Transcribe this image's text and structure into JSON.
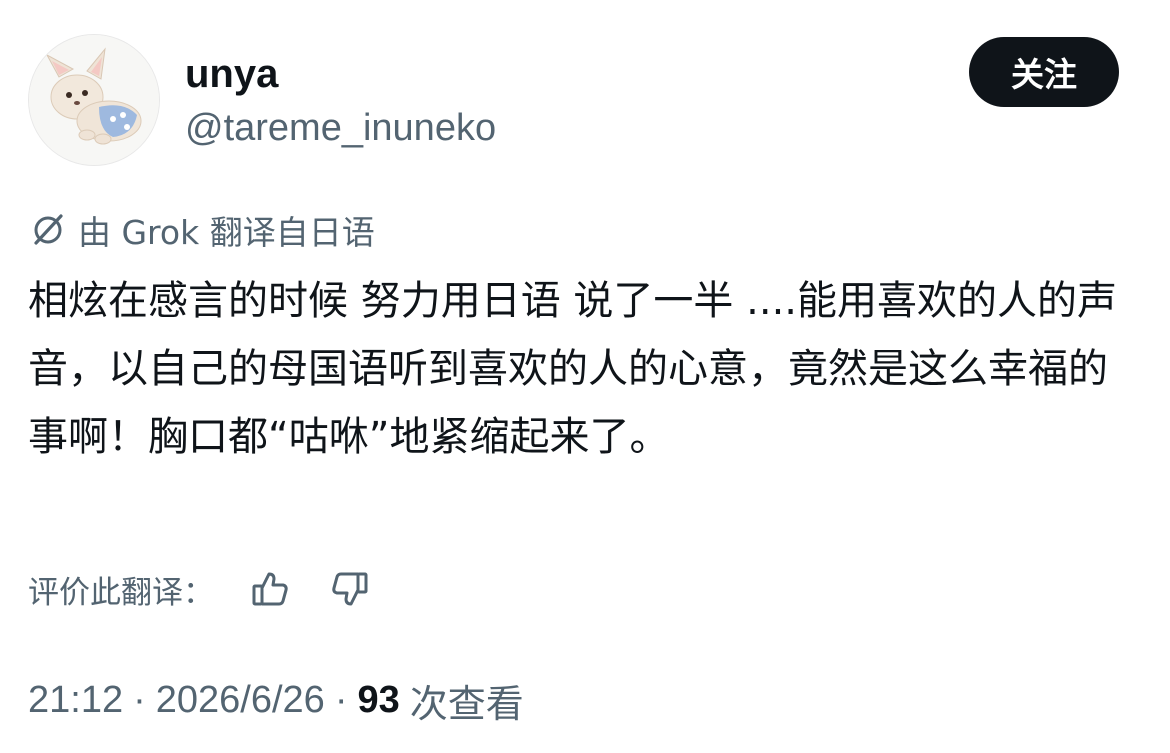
{
  "user": {
    "display_name": "unya",
    "handle": "@tareme_inuneko",
    "follow_label": "关注"
  },
  "translation": {
    "note": "由 Grok 翻译自日语"
  },
  "tweet": {
    "text": "相炫在感言的时候 努力用日语 说了一半 ....能用喜欢的人的声音，以自己的母国语听到喜欢的人的心意，竟然是这么幸福的事啊！胸口都“咕咻”地紧缩起来了。"
  },
  "rating": {
    "label": "评价此翻译：",
    "up_icon": "thumbs-up-icon",
    "down_icon": "thumbs-down-icon"
  },
  "meta": {
    "time": "21:12",
    "separator": "·",
    "date": "2026/6/26",
    "views_count": "93",
    "views_label": "次查看"
  },
  "colors": {
    "text": "#0f1419",
    "secondary": "#536471",
    "button_bg": "#0f1419",
    "button_text": "#ffffff"
  }
}
